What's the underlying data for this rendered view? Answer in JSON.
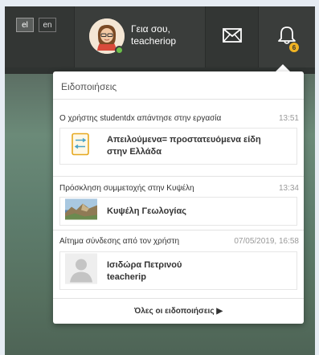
{
  "header": {
    "languages": [
      {
        "code": "el",
        "active": true
      },
      {
        "code": "en",
        "active": false
      }
    ],
    "user": {
      "greeting": "Γεια σου,",
      "username": "teacheriop",
      "status_color": "#6cc04a"
    },
    "messages_icon": "envelope-icon",
    "notifications_icon": "bell-icon",
    "notifications_count": "6",
    "badge_color": "#f0b323"
  },
  "notifications_panel": {
    "title": "Ειδοποιήσεις",
    "items": [
      {
        "heading": "Ο χρήστης studentdx απάντησε στην εργασία",
        "time": "13:51",
        "card_line1": "Απειλούμενα= προστατευόμενα είδη",
        "card_line2": "στην Ελλάδα",
        "thumb": "assignment-icon"
      },
      {
        "heading": "Πρόσκληση συμμετοχής στην Κυψέλη",
        "time": "13:34",
        "card_line1": "Κυψέλη Γεωλογίας",
        "thumb": "landscape-thumbnail"
      },
      {
        "heading": "Αίτημα σύνδεσης από τον χρήστη",
        "time": "07/05/2019, 16:58",
        "card_line1": "Ισιδώρα Πετρινού",
        "card_line2": "teacherip",
        "thumb": "user-placeholder"
      }
    ],
    "all_link": "Όλες οι ειδοποιήσεις ▶"
  }
}
